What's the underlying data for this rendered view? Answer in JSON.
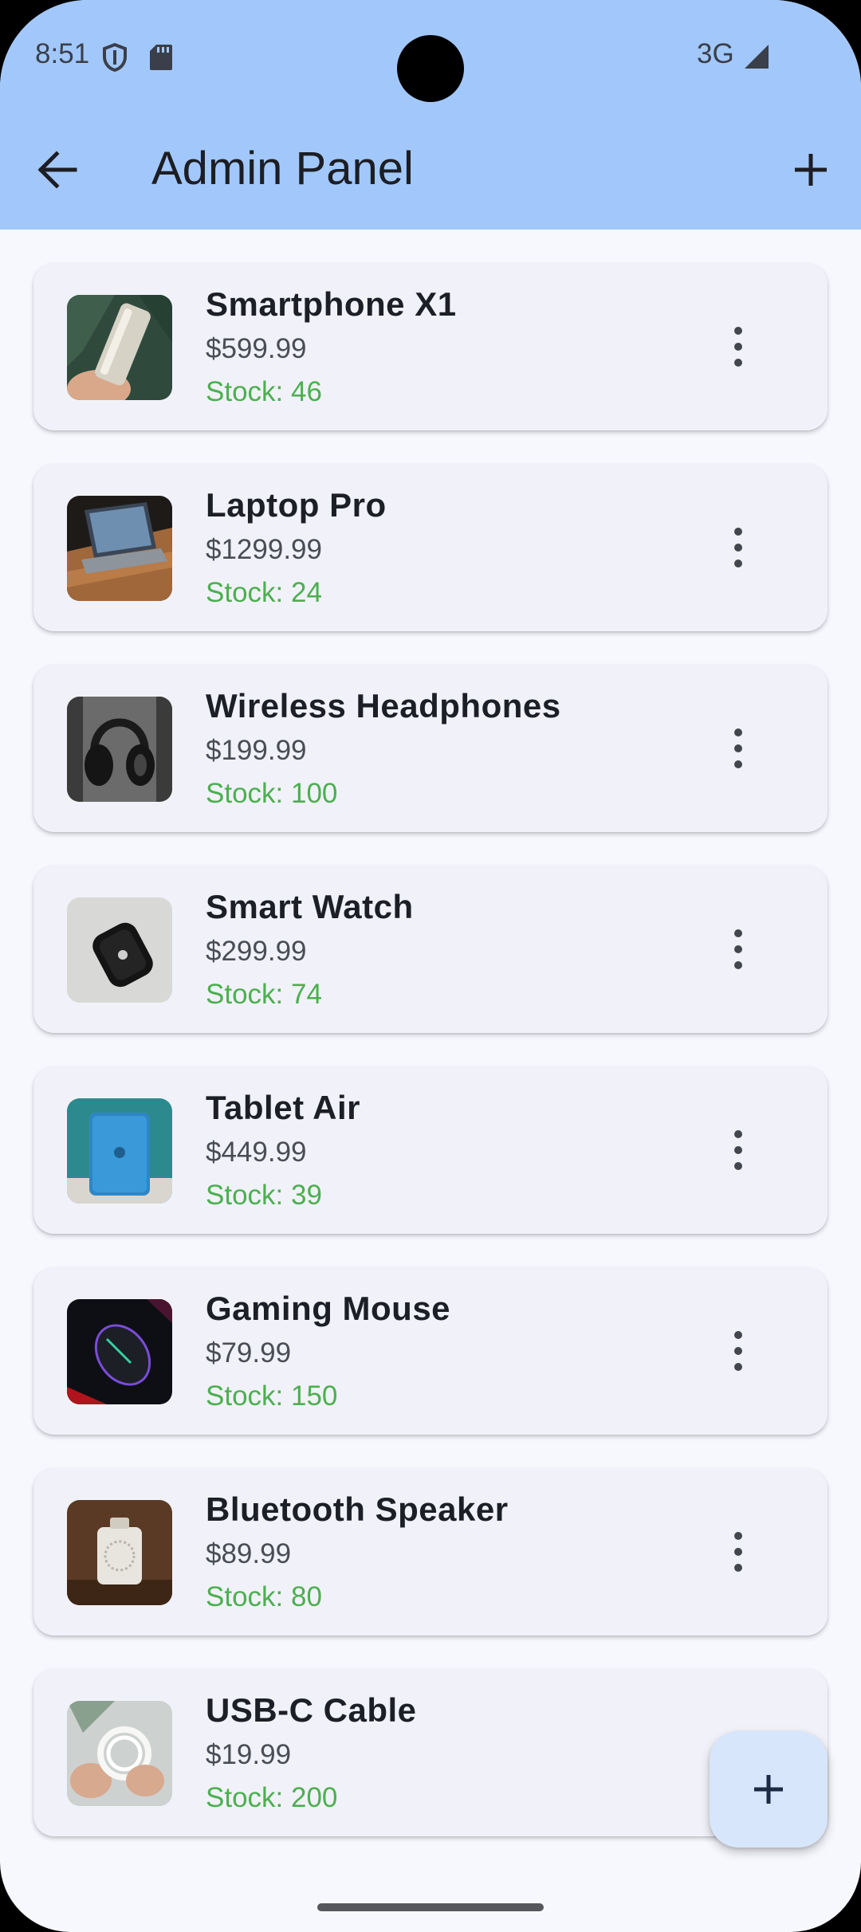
{
  "status_bar": {
    "time": "8:51",
    "network": "3G",
    "icons": [
      "shield-icon",
      "sd-card-icon",
      "signal-icon"
    ]
  },
  "app_bar": {
    "title": "Admin Panel",
    "back_icon": "arrow-back-icon",
    "add_icon": "add-icon",
    "background": "#a2c8fb"
  },
  "products": [
    {
      "name": "Smartphone X1",
      "price": "$599.99",
      "stock": "Stock: 46"
    },
    {
      "name": "Laptop Pro",
      "price": "$1299.99",
      "stock": "Stock: 24"
    },
    {
      "name": "Wireless Headphones",
      "price": "$199.99",
      "stock": "Stock: 100"
    },
    {
      "name": "Smart Watch",
      "price": "$299.99",
      "stock": "Stock: 74"
    },
    {
      "name": "Tablet Air",
      "price": "$449.99",
      "stock": "Stock: 39"
    },
    {
      "name": "Gaming Mouse",
      "price": "$79.99",
      "stock": "Stock: 150"
    },
    {
      "name": "Bluetooth Speaker",
      "price": "$89.99",
      "stock": "Stock: 80"
    },
    {
      "name": "USB-C Cable",
      "price": "$19.99",
      "stock": "Stock: 200"
    }
  ],
  "colors": {
    "stock_text": "#4caf50",
    "card_bg": "#f1f2f9",
    "fab_bg": "#d8e6fb"
  },
  "fab": {
    "icon": "add-icon"
  }
}
